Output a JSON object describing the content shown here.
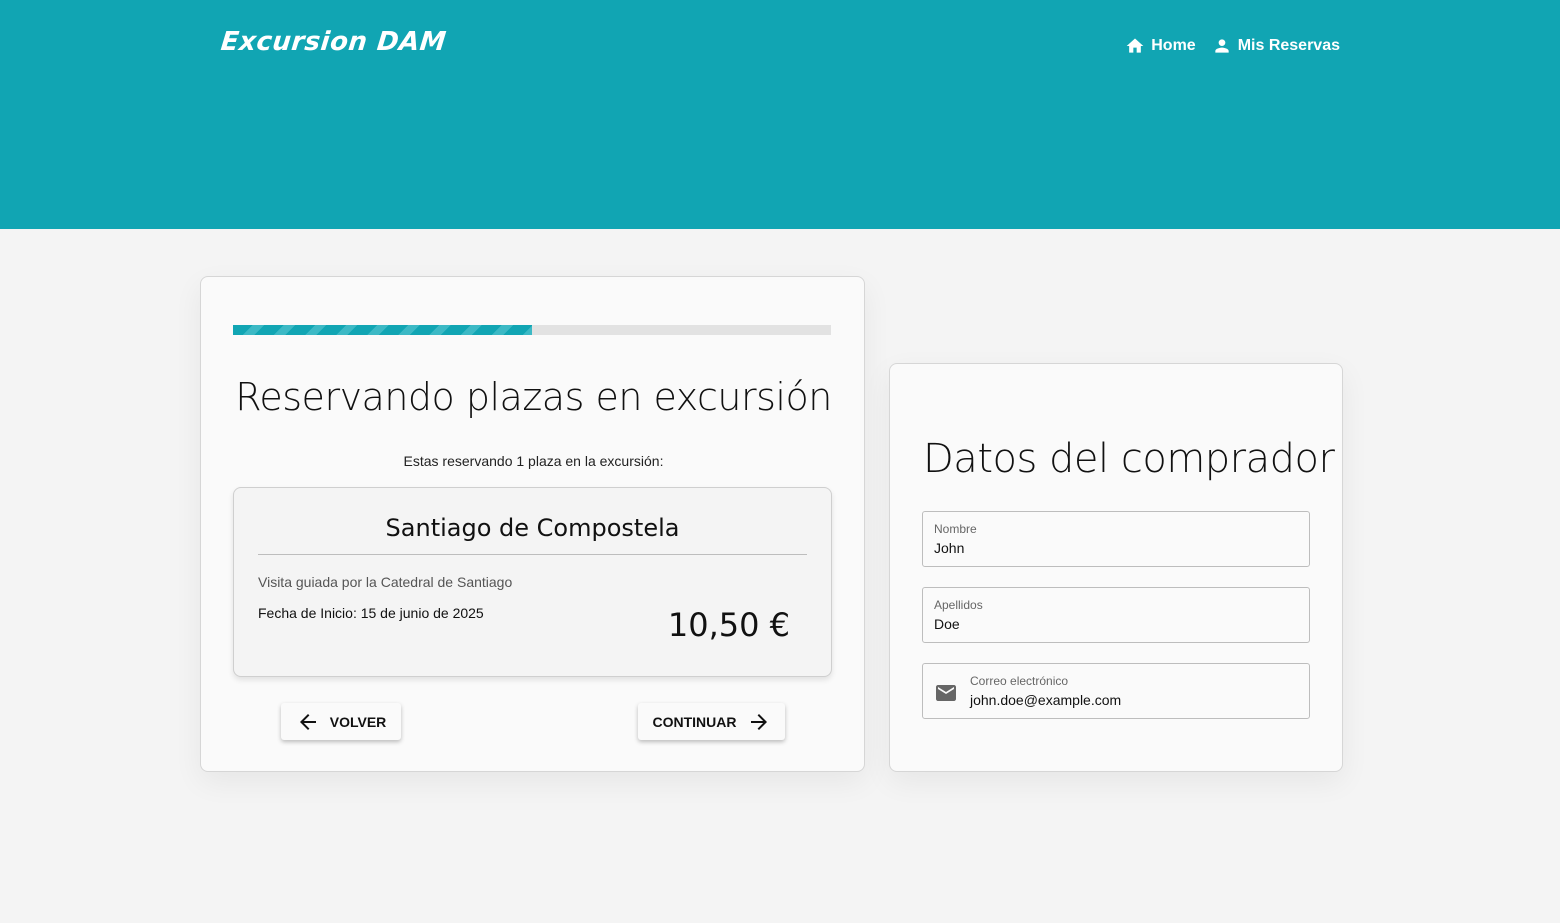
{
  "app": {
    "brand": "Excursion DAM",
    "nav": [
      {
        "label": "Home",
        "icon": "home-icon"
      },
      {
        "label": "Mis Reservas",
        "icon": "person-icon"
      }
    ],
    "colors": {
      "primary": "#11a5b3",
      "background": "#f4f4f4"
    }
  },
  "booking": {
    "progress": 0.5,
    "title": "Reservando plazas en excursión",
    "subtitle": "Estas reservando 1 plaza en la excursión:",
    "excursion": {
      "name": "Santiago de Compostela",
      "description": "Visita guiada por la Catedral de Santiago",
      "date": "Fecha de Inicio: 15 de junio de 2025",
      "price": "10,50 €"
    },
    "back_label": "VOLVER",
    "next_label": "CONTINUAR"
  },
  "buyer": {
    "title": "Datos del comprador",
    "fields": [
      {
        "label": "Nombre",
        "value": "John"
      },
      {
        "label": "Apellidos",
        "value": "Doe"
      },
      {
        "label": "Correo electrónico",
        "value": "john.doe@example.com",
        "icon": "mail-icon"
      }
    ]
  }
}
